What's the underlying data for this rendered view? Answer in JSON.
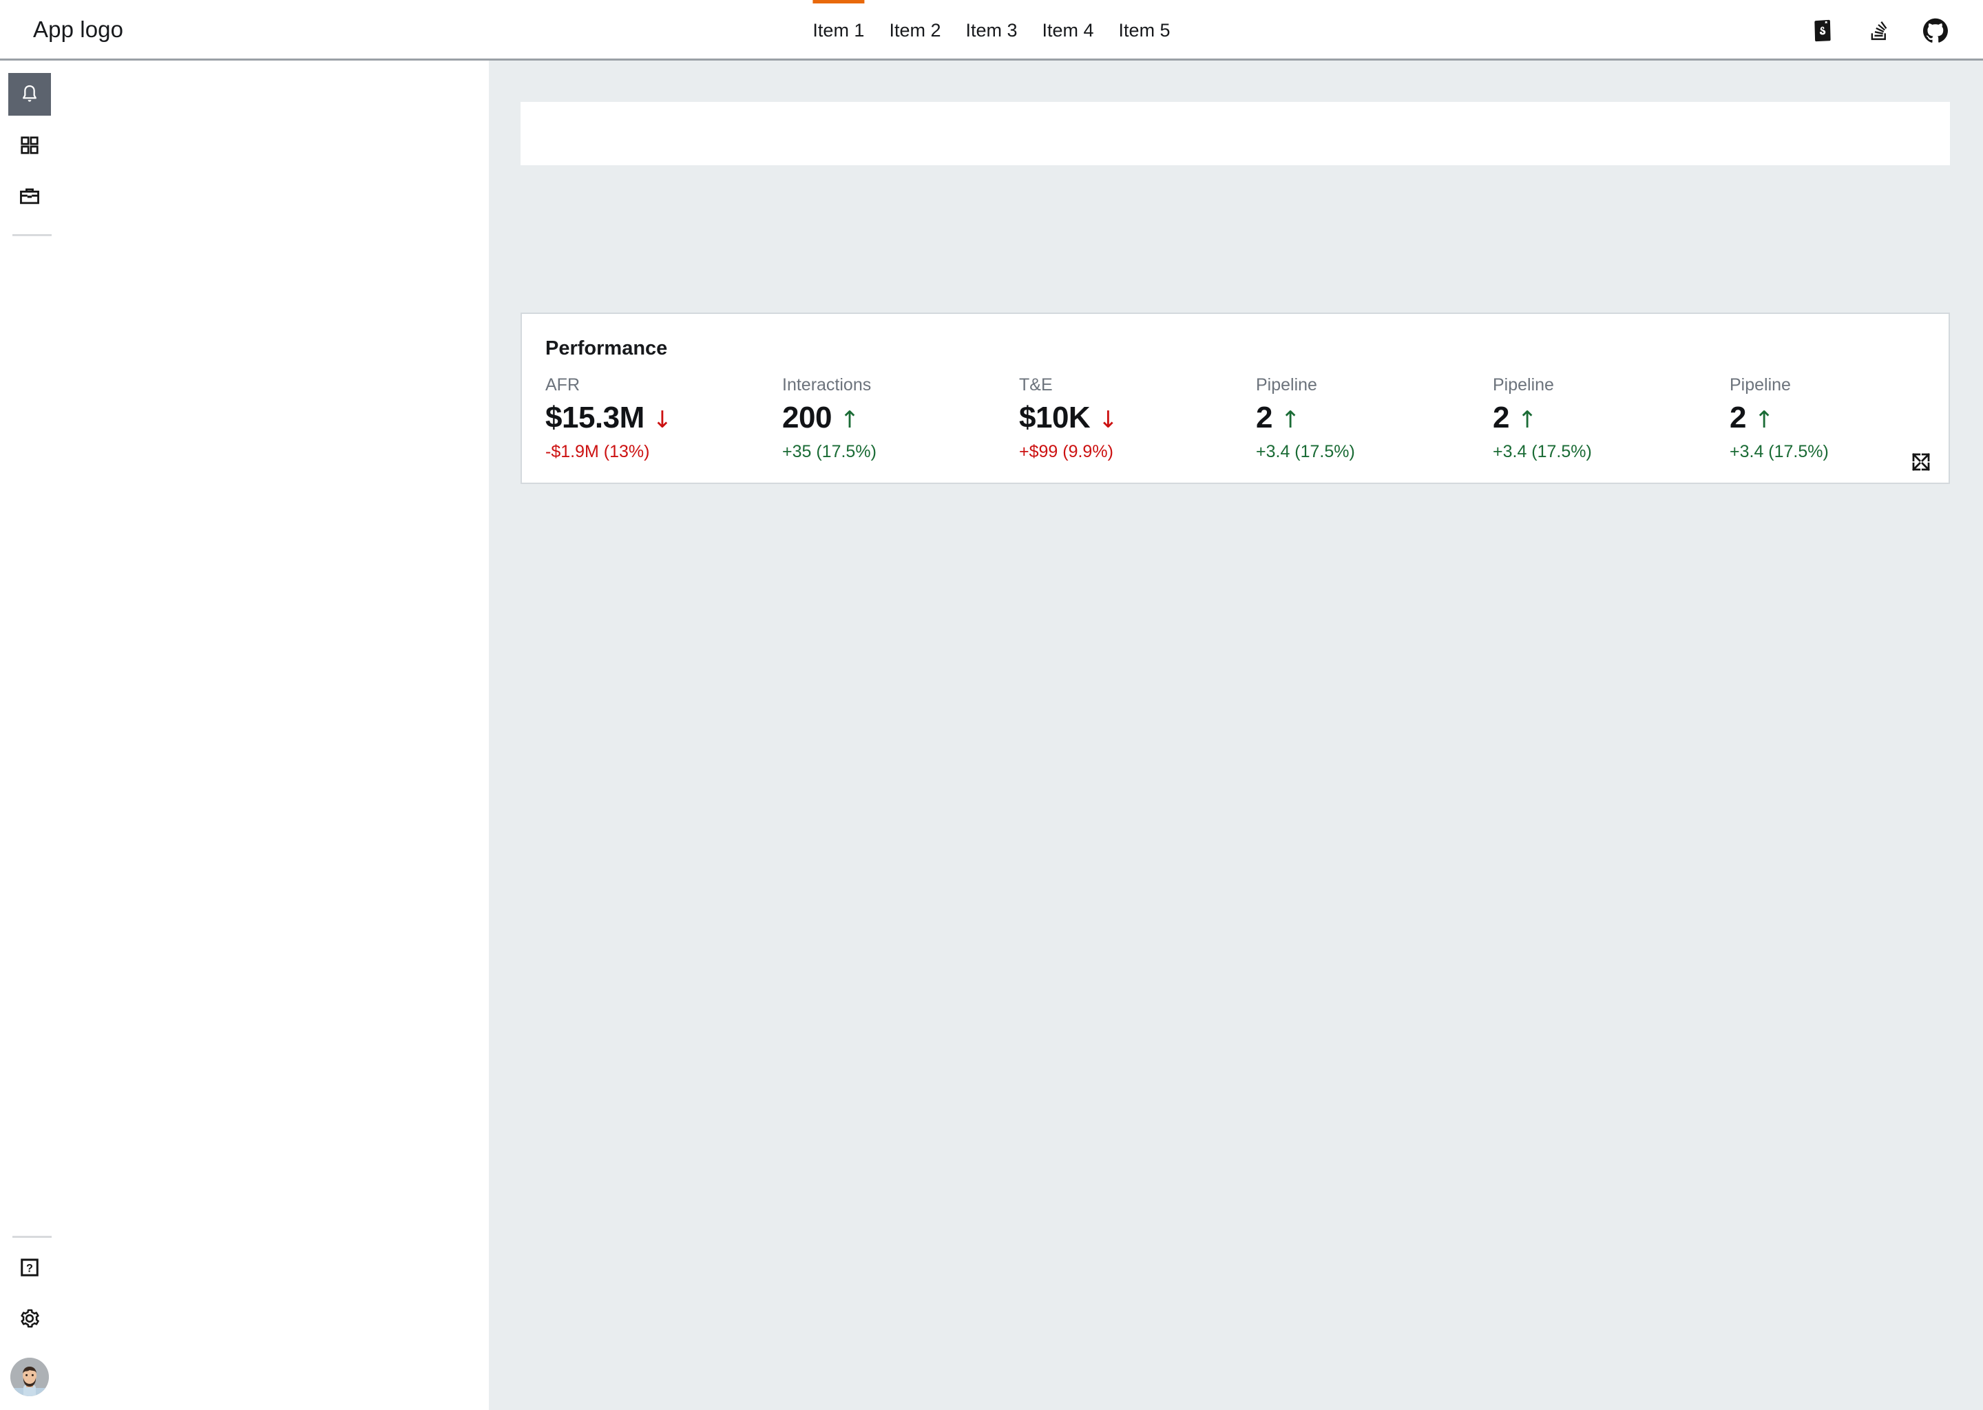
{
  "header": {
    "brand": "App logo",
    "nav": [
      {
        "label": "Item 1",
        "active": true
      },
      {
        "label": "Item 2",
        "active": false
      },
      {
        "label": "Item 3",
        "active": false
      },
      {
        "label": "Item 4",
        "active": false
      },
      {
        "label": "Item 5",
        "active": false
      }
    ],
    "icons": [
      {
        "name": "storybook-icon"
      },
      {
        "name": "stackoverflow-icon"
      },
      {
        "name": "github-icon"
      }
    ],
    "active_accent_color": "#e8690b"
  },
  "sidebar": {
    "top_items": [
      {
        "name": "notifications-bell-icon",
        "active": true
      },
      {
        "name": "apps-grid-icon",
        "active": false
      },
      {
        "name": "briefcase-icon",
        "active": false
      }
    ],
    "bottom_items": [
      {
        "name": "help-icon",
        "active": false
      },
      {
        "name": "settings-gear-icon",
        "active": false
      }
    ],
    "avatar": {
      "name": "user-avatar"
    }
  },
  "main": {
    "card": {
      "title": "Performance",
      "expand_icon": "expand-arrows-icon",
      "metrics": [
        {
          "label": "AFR",
          "value": "$15.3M",
          "direction": "down",
          "arrow": "↓",
          "delta": "-$1.9M (13%)",
          "delta_tone": "negative"
        },
        {
          "label": "Interactions",
          "value": "200",
          "direction": "up",
          "arrow": "↑",
          "delta": "+35 (17.5%)",
          "delta_tone": "positive"
        },
        {
          "label": "T&E",
          "value": "$10K",
          "direction": "down",
          "arrow": "↓",
          "delta": "+$99 (9.9%)",
          "delta_tone": "negative"
        },
        {
          "label": "Pipeline",
          "value": "2",
          "direction": "up",
          "arrow": "↑",
          "delta": "+3.4 (17.5%)",
          "delta_tone": "positive"
        },
        {
          "label": "Pipeline",
          "value": "2",
          "direction": "up",
          "arrow": "↑",
          "delta": "+3.4 (17.5%)",
          "delta_tone": "positive"
        },
        {
          "label": "Pipeline",
          "value": "2",
          "direction": "up",
          "arrow": "↑",
          "delta": "+3.4 (17.5%)",
          "delta_tone": "positive"
        }
      ]
    },
    "colors": {
      "background": "#e9edef",
      "panel": "#ffffff",
      "positive": "#1a6b35",
      "negative": "#cc1111"
    }
  }
}
